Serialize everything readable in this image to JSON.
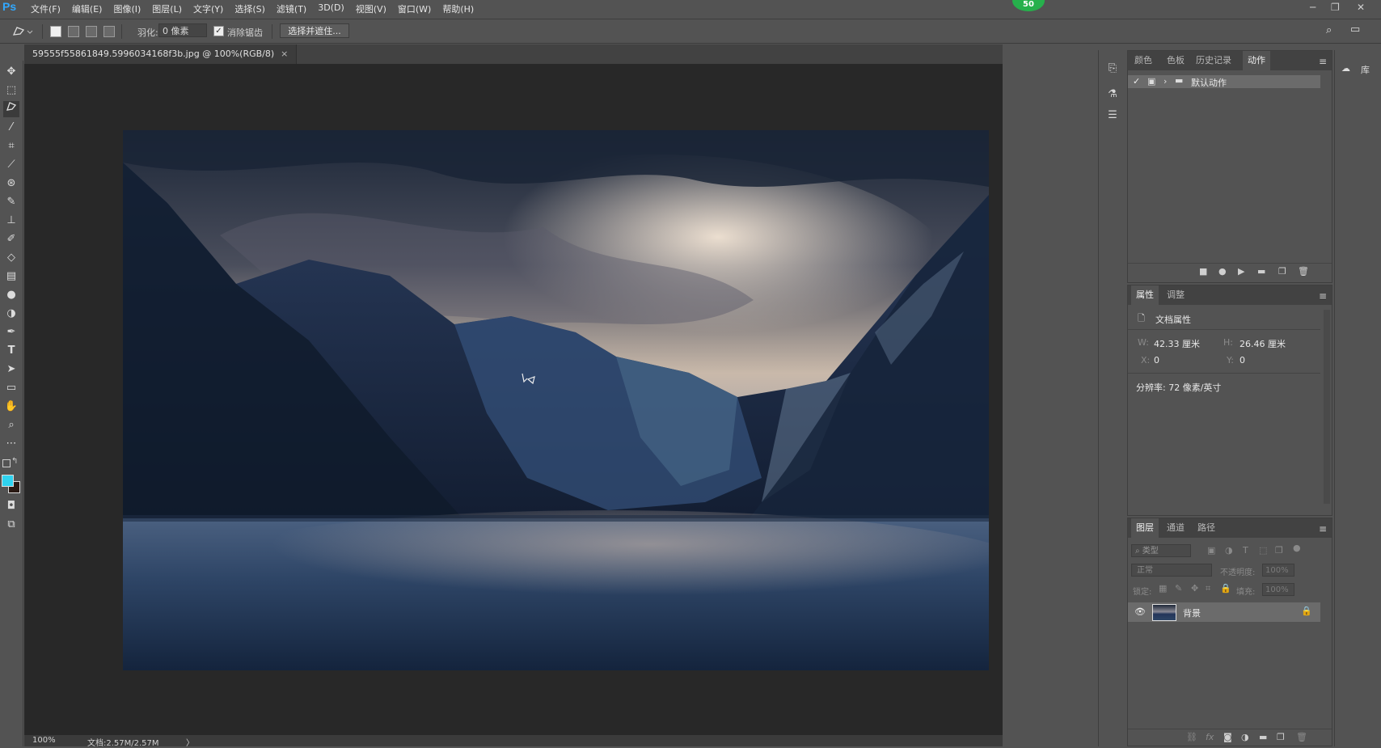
{
  "app": {
    "logo": "Ps",
    "menus": [
      "文件(F)",
      "编辑(E)",
      "图像(I)",
      "图层(L)",
      "文字(Y)",
      "选择(S)",
      "滤镜(T)",
      "3D(D)",
      "视图(V)",
      "窗口(W)",
      "帮助(H)"
    ],
    "badge": "50",
    "window_controls": [
      "─",
      "❐",
      "✕"
    ]
  },
  "options": {
    "feather_label": "羽化:",
    "feather_value": "0 像素",
    "antialias_label": "消除锯齿",
    "antialias_checked": true,
    "select_mask_button": "选择并遮住..."
  },
  "document": {
    "tab_title": "59555f55861849.5996034168f3b.jpg @ 100%(RGB/8)",
    "tab_close": "×",
    "zoom": "100%",
    "doc_info": "文档:2.57M/2.57M",
    "status_arrow": "〉"
  },
  "colors": {
    "foreground": "#2fd3f0",
    "background": "#2a1a14",
    "accent": "#31a8ff",
    "badge": "#26b04c"
  },
  "panels": {
    "actions": {
      "tabs": [
        "颜色",
        "色板",
        "历史记录",
        "动作"
      ],
      "active_tab": "动作",
      "items": [
        {
          "label": "默认动作",
          "checked": true
        }
      ],
      "footer_icons": [
        "stop-icon",
        "record-icon",
        "play-icon",
        "folder-icon",
        "new-icon",
        "trash-icon"
      ]
    },
    "properties": {
      "tabs": [
        "属性",
        "调整"
      ],
      "active_tab": "属性",
      "title": "文档属性",
      "w_label": "W:",
      "w_value": "42.33 厘米",
      "h_label": "H:",
      "h_value": "26.46 厘米",
      "x_label": "X:",
      "x_value": "0",
      "y_label": "Y:",
      "y_value": "0",
      "resolution": "分辨率: 72 像素/英寸"
    },
    "layers": {
      "tabs": [
        "图层",
        "通道",
        "路径"
      ],
      "active_tab": "图层",
      "filter_placeholder": "类型",
      "blend_mode": "正常",
      "opacity_label": "不透明度:",
      "opacity_value": "100%",
      "lock_label": "锁定:",
      "fill_label": "填充:",
      "fill_value": "100%",
      "layers": [
        {
          "name": "背景",
          "visible": true,
          "locked": true
        }
      ]
    },
    "library_label": "库"
  }
}
